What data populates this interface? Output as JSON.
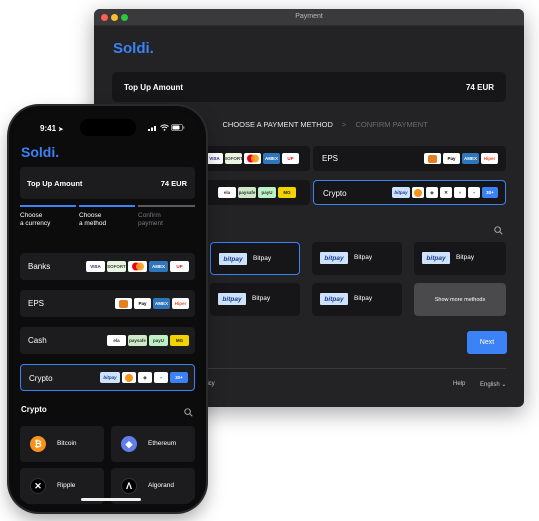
{
  "desktop": {
    "window_title": "Payment",
    "brand": "Soldi.",
    "top_up": {
      "label": "Top Up Amount",
      "amount": "74 EUR"
    },
    "steps": {
      "sep1": ">",
      "current": "CHOOSE A PAYMENT METHOD",
      "sep2": ">",
      "next": "CONFIRM PAYMENT"
    },
    "methods": [
      {
        "label": "EPS"
      },
      {
        "label": "Crypto"
      }
    ],
    "badge_30": "30+",
    "crypto_methods": [
      {
        "brand": "bitpay",
        "name": "Bitpay"
      },
      {
        "brand": "bitpay",
        "name": "Bitpay"
      },
      {
        "brand": "bitpay",
        "name": "Bitpay"
      },
      {
        "brand": "bitpay",
        "name": "Bitpay"
      },
      {
        "brand": "bitpay",
        "name": "Bitpay"
      }
    ],
    "show_more": "Show more methods",
    "next_button": "Next",
    "footer": {
      "policy_fragment": "licy",
      "help": "Help",
      "language": "English"
    }
  },
  "phone": {
    "time": "9:41",
    "brand": "Soldi.",
    "top_up": {
      "label": "Top Up Amount",
      "amount": "74 EUR"
    },
    "steps": [
      {
        "line1": "Choose",
        "line2": "a currency"
      },
      {
        "line1": "Choose",
        "line2": "a method"
      },
      {
        "line1": "Confirm",
        "line2": "payment"
      }
    ],
    "methods": [
      {
        "label": "Banks"
      },
      {
        "label": "EPS"
      },
      {
        "label": "Cash"
      },
      {
        "label": "Crypto"
      }
    ],
    "badge_30": "30+",
    "crypto_title": "Crypto",
    "coins": [
      {
        "name": "Bitcoin",
        "icon": "bitcoin-icon"
      },
      {
        "name": "Ethereum",
        "icon": "ethereum-icon"
      },
      {
        "name": "Ripple",
        "icon": "ripple-icon"
      },
      {
        "name": "Algorand",
        "icon": "algorand-icon"
      }
    ]
  },
  "logo_labels": {
    "visa": "VISA",
    "sofort": "SOFORT",
    "mastercard": "MC",
    "amex": "AMEX",
    "unionpay": "UP",
    "gpay": "G",
    "applepay": "Pay",
    "amex2": "AMEX",
    "hiper": "Hiper",
    "ela": "ela",
    "paysafe": "paysafe",
    "payu": "payU",
    "moneygram": "MG",
    "bitpay": "bitpay"
  },
  "colors": {
    "accent": "#3b82f6",
    "window_bg": "#232325",
    "card_bg": "#161618",
    "phone_card_bg": "#1c1c1e",
    "bitcoin": "#f7931a"
  }
}
